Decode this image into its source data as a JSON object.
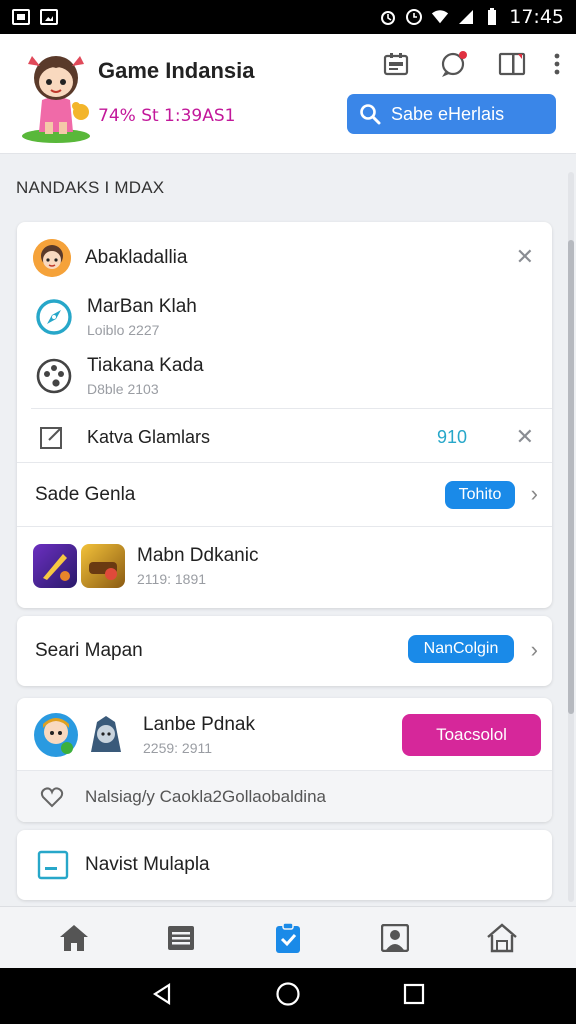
{
  "status_bar": {
    "time": "17:45"
  },
  "header": {
    "title": "Game Indansia",
    "subtitle": "74% St 1:39AS1",
    "search_label": "Sabe eHerlais"
  },
  "section_title": "NANDAKS I MDAX",
  "card1": {
    "row1": {
      "title": "Abakladallia"
    },
    "row2": {
      "title": "MarBan Klah",
      "sub": "Loiblo 2227"
    },
    "row3": {
      "title": "Tiakana Kada",
      "sub": "D8ble 2103"
    },
    "row4": {
      "title": "Katva Glamlars",
      "value": "910"
    },
    "row5": {
      "title": "Sade Genla",
      "badge": "Tohito"
    },
    "row6": {
      "title": "Mabn Ddkanic",
      "sub": "2119: 1891"
    }
  },
  "card2": {
    "title": "Seari Mapan",
    "badge": "NanColgin"
  },
  "card3": {
    "title": "Lanbe Pdnak",
    "sub": "2259: 2911",
    "button": "Toacsolol",
    "footer": "Nalsiag/y Caokla2Gollaobaldina"
  },
  "card4": {
    "title": "Navist Mulapla"
  },
  "colors": {
    "accent_blue": "#3a86e8",
    "badge_blue": "#1a8ae8",
    "magenta": "#d6279a",
    "teal": "#27a7c9"
  }
}
